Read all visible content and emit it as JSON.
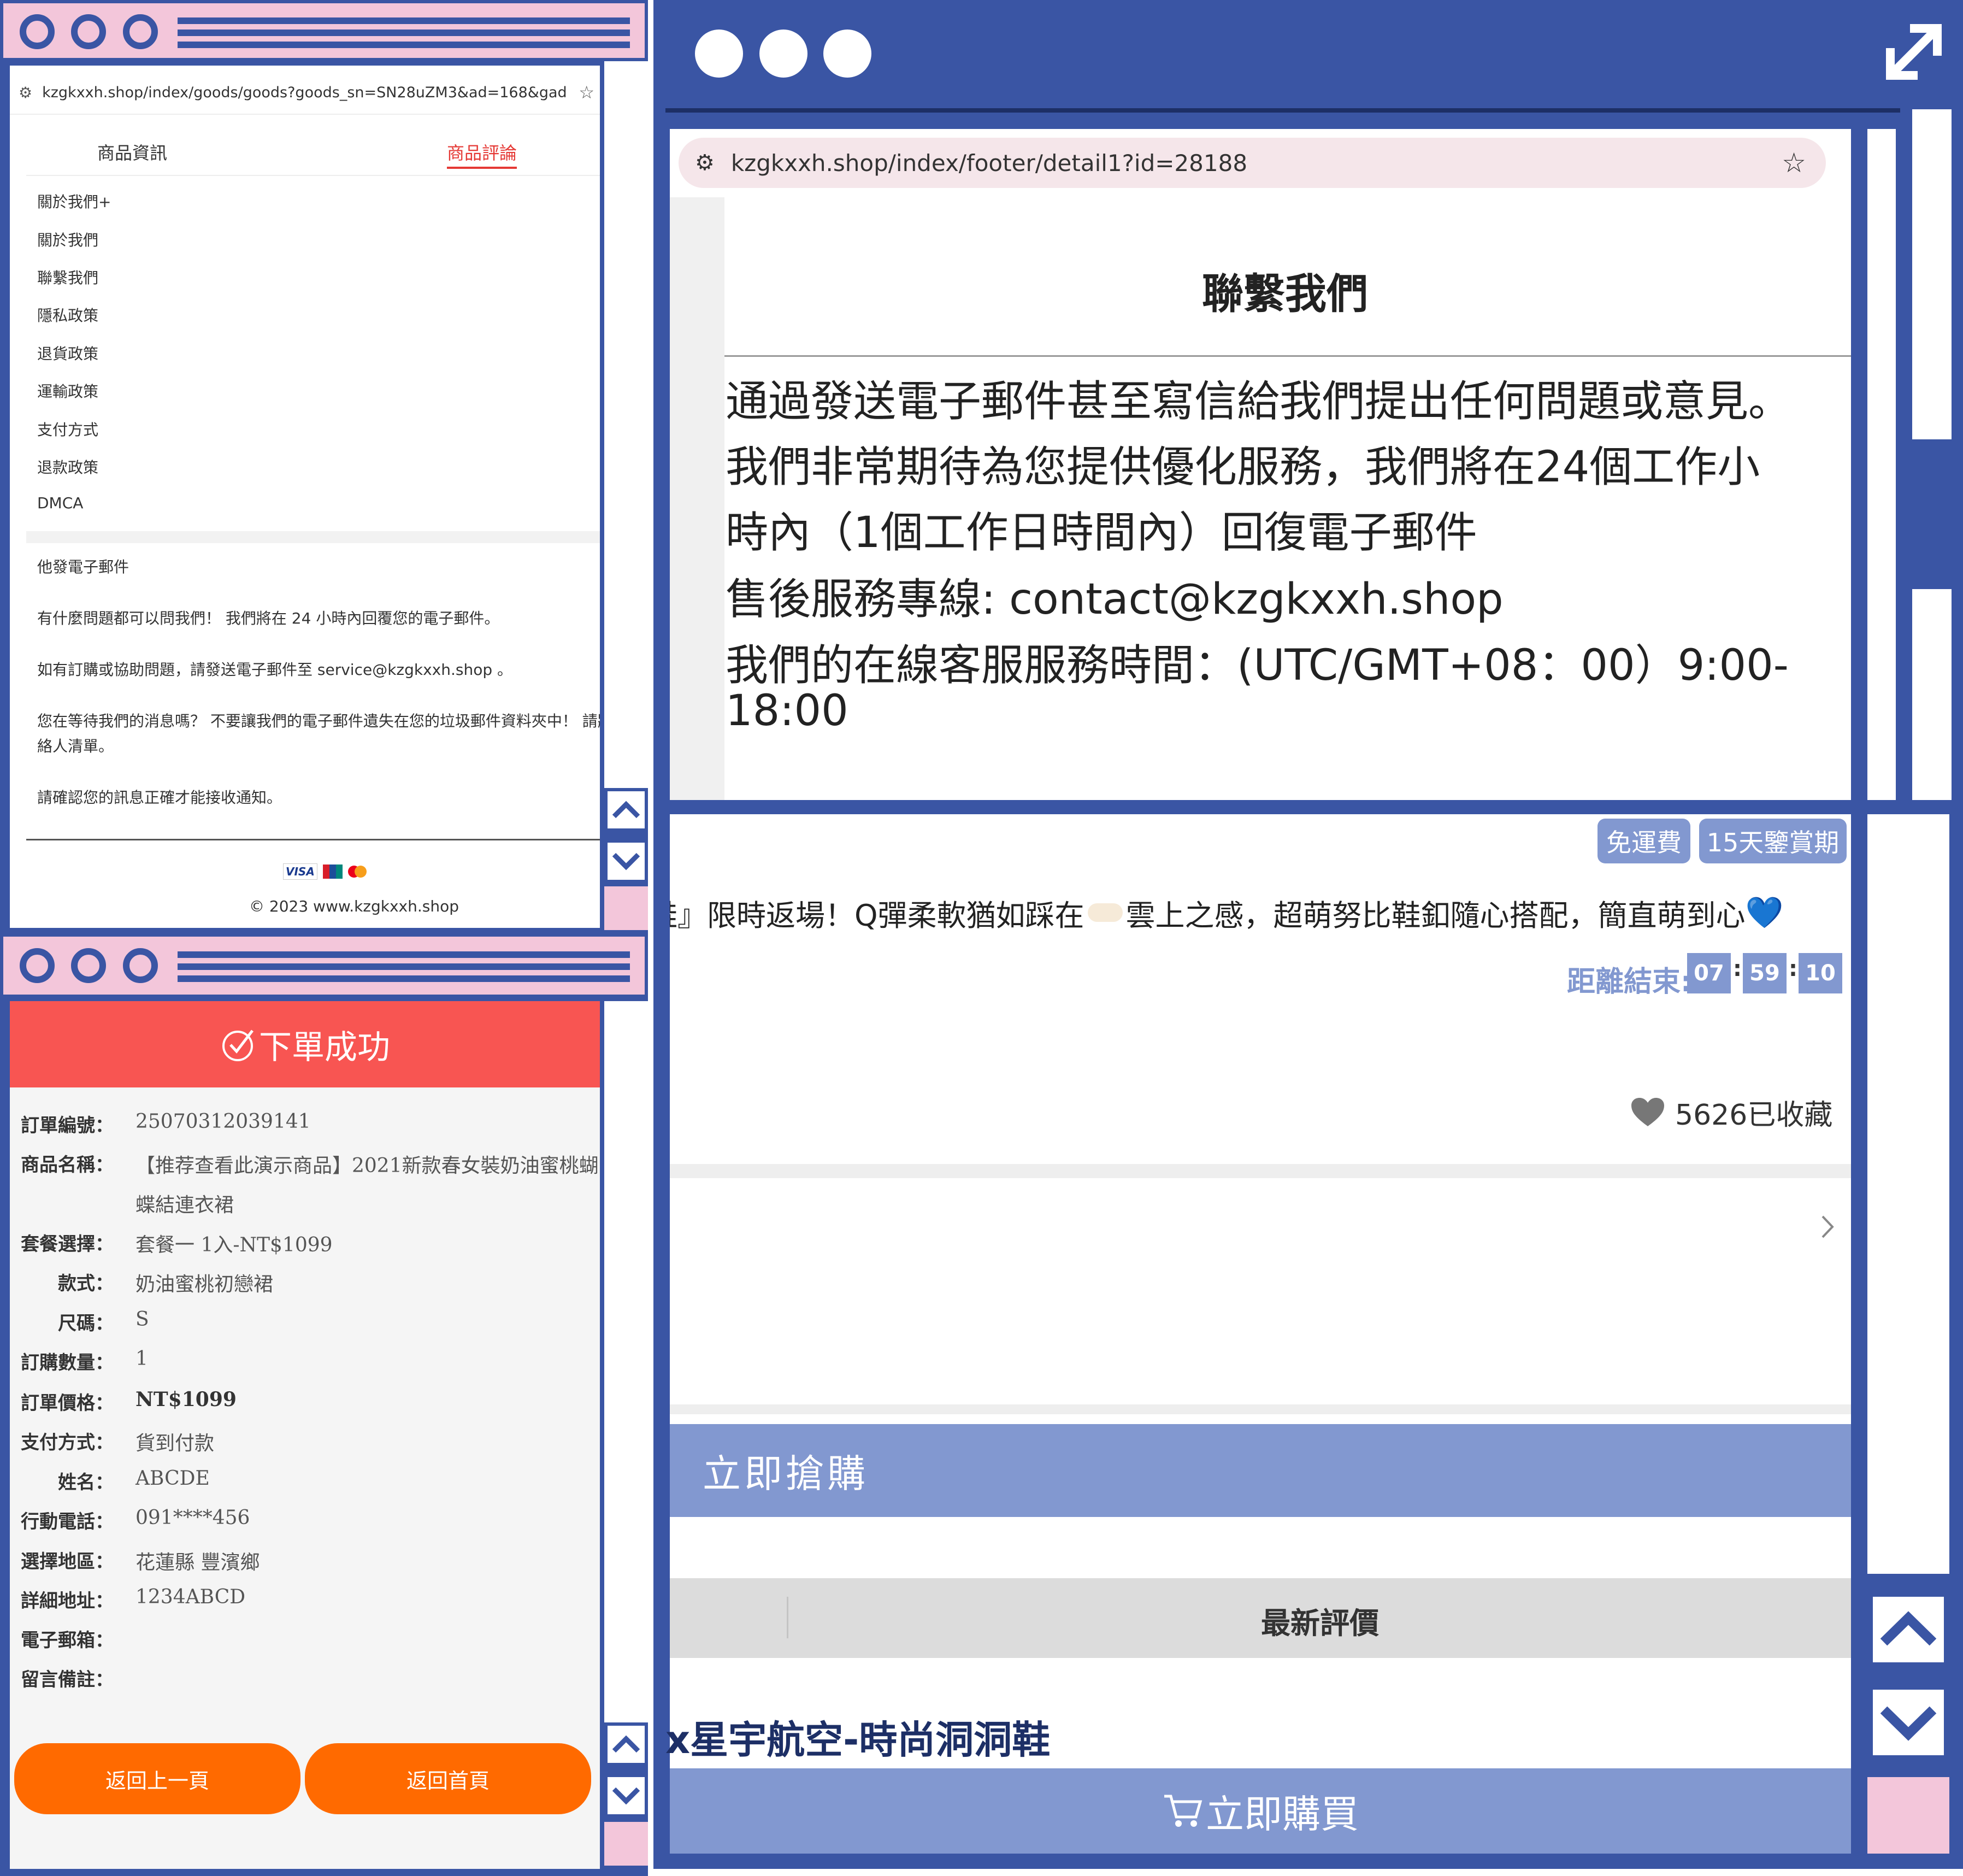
{
  "left_top_window": {
    "url": "kzgkxxh.shop/index/goods/goods?goods_sn=SN28uZM3&ad=168&gad_source=...",
    "tabs": [
      "商品資訊",
      "商品評論"
    ],
    "active_tab": 1,
    "menu": [
      "關於我們+",
      "關於我們",
      "聯繫我們",
      "隱私政策",
      "退貨政策",
      "運輸政策",
      "支付方式",
      "退款政策",
      "DMCA"
    ],
    "email_heading": "他發電子郵件",
    "paragraphs": [
      "有什麼問題都可以問我們！ 我們將在 24 小時內回覆您的電子郵件。",
      "如有訂購或協助問題，請發送電子郵件至 service@kzgkxxh.shop 。",
      "您在等待我們的消息嗎？ 不要讓我們的電子郵件遺失在您的垃圾郵件資料夾中！ 請將我們加入您的",
      "絡人清單。",
      "請確認您的訊息正確才能接收通知。"
    ],
    "payment_icons": [
      "VISA",
      "unionpay-icon",
      "mastercard-icon"
    ],
    "copyright": "© 2023 www.kzgkxxh.shop"
  },
  "order_window": {
    "banner": "下單成功",
    "rows": [
      {
        "label": "訂單編號：",
        "value": "25070312039141"
      },
      {
        "label": "商品名稱：",
        "value": "【推荐查看此演示商品】2021新款春女裝奶油蜜桃蝴"
      },
      {
        "label": "",
        "value": "蝶結連衣裙"
      },
      {
        "label": "套餐選擇：",
        "value": "套餐一 1入-NT$1099"
      },
      {
        "label": "款式：",
        "value": "奶油蜜桃初戀裙"
      },
      {
        "label": "尺碼：",
        "value": "S"
      },
      {
        "label": "訂購數量：",
        "value": "1"
      },
      {
        "label": "訂單價格：",
        "value": "NT$1099"
      },
      {
        "label": "支付方式：",
        "value": "貨到付款"
      },
      {
        "label": "姓名：",
        "value": "ABCDE"
      },
      {
        "label": "行動電話：",
        "value": "091****456"
      },
      {
        "label": "選擇地區：",
        "value": "花蓮縣 豐濱鄉"
      },
      {
        "label": "詳細地址：",
        "value": "1234ABCD"
      },
      {
        "label": "電子郵箱：",
        "value": ""
      },
      {
        "label": "留言備註：",
        "value": ""
      }
    ],
    "back_button": "返回上一頁",
    "home_button": "返回首頁"
  },
  "right_window": {
    "url": "kzgkxxh.shop/index/footer/detail1?id=28188",
    "contact_title": "聯繫我們",
    "contact_lines": [
      "通過發送電子郵件甚至寫信給我們提出任何問題或意見。",
      "我們非常期待為您提供優化服務，我們將在24個工作小",
      "時內（1個工作日時間內）回復電子郵件",
      "售後服務專線: contact@kzgkxxh.shop",
      "我們的在線客服服務時間：(UTC/GMT+08：00）9:00-",
      "18:00"
    ],
    "badges": [
      "免運費",
      "15天鑒賞期"
    ],
    "promo": "鞋』限時返場！Q彈柔軟猶如踩在",
    "promo_tail": "雲上之感，超萌努比鞋釦隨心搭配，簡直萌到心",
    "countdown_label": "距離結束:",
    "countdown": [
      "07",
      "59",
      "10"
    ],
    "favorites": "5626已收藏",
    "buy_now_bar": "立即搶購",
    "reviews_tab": "最新評價",
    "product_title": "x星宇航空-時尚洞洞鞋",
    "buy_button": "立即購買"
  },
  "colors": {
    "frame_blue": "#3a55a4",
    "frame_pink": "#f3c6da",
    "success_red": "#f85552",
    "orange": "#ff6a00",
    "periwinkle": "#8298d0"
  }
}
